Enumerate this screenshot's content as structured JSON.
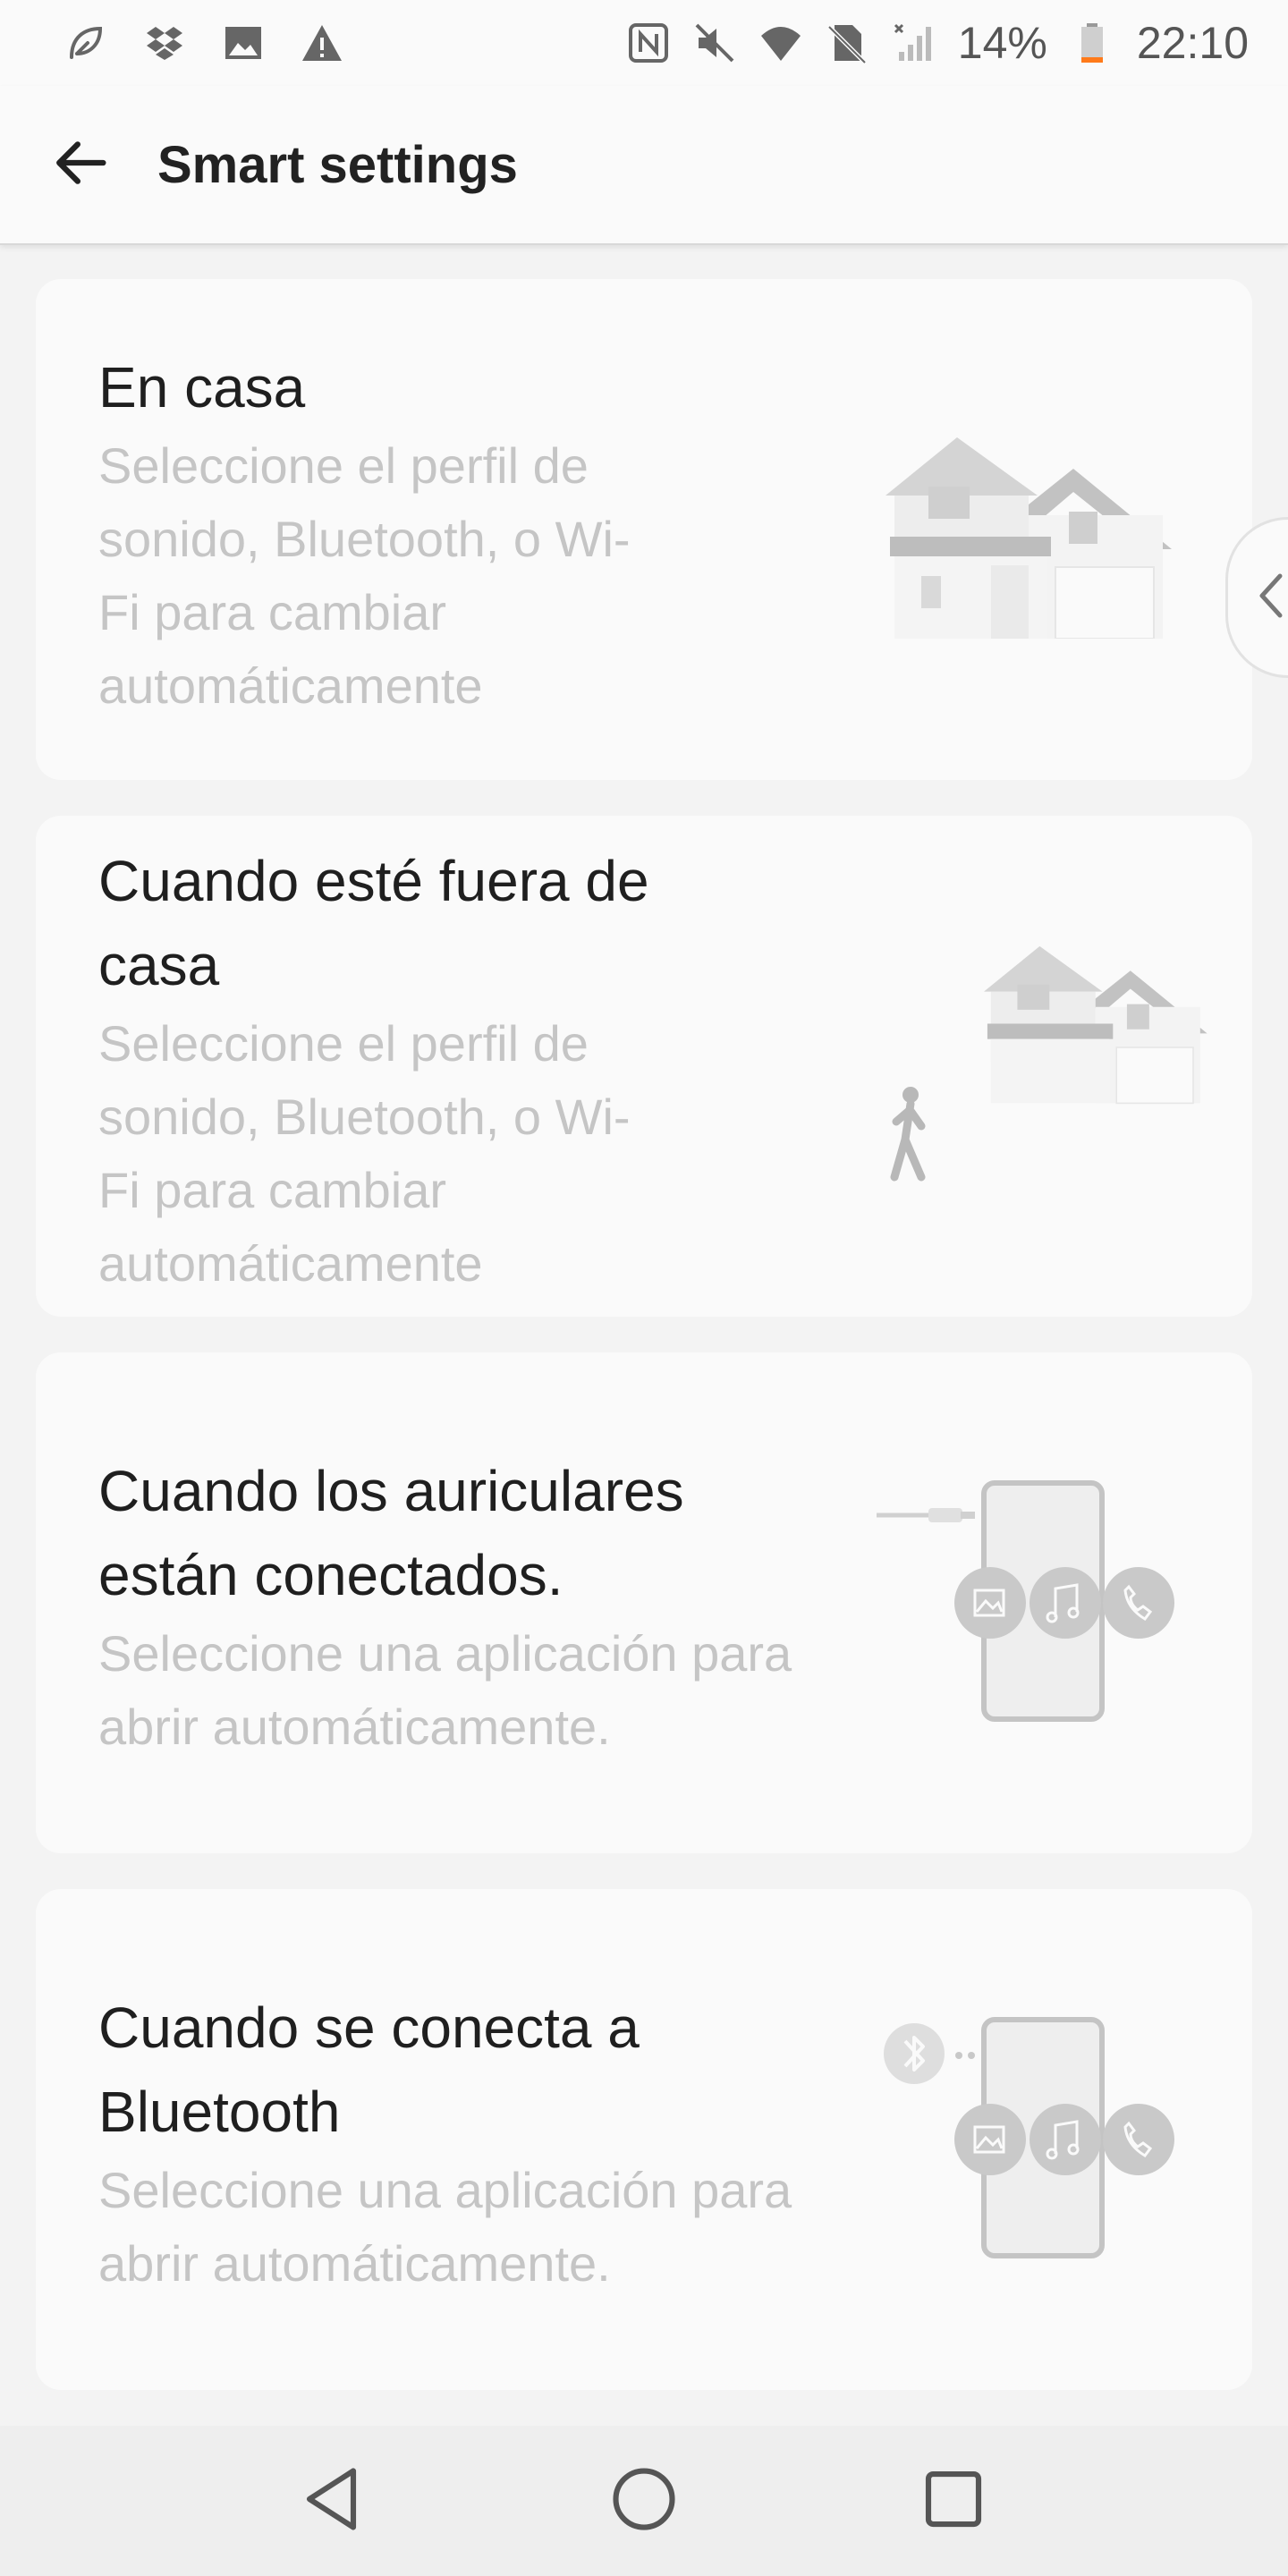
{
  "status_bar": {
    "left_icons": [
      "leaf-icon",
      "dropbox-icon",
      "image-icon",
      "warning-icon"
    ],
    "right_icons": [
      "nfc-icon",
      "mute-icon",
      "wifi-icon",
      "no-sim-icon",
      "signal-icon",
      "battery-icon"
    ],
    "battery_percent": "14%",
    "time": "22:10",
    "battery_level": 0.14,
    "battery_color": "#ff7a1a"
  },
  "app_bar": {
    "title": "Smart settings",
    "back_icon": "arrow-back-icon"
  },
  "cards": [
    {
      "title": "En casa",
      "description": "Seleccione el perfil de sonido, Bluetooth, o Wi-Fi para cambiar automáticamente",
      "illustration": "house-icon"
    },
    {
      "title": "Cuando esté fuera de casa",
      "description": "Seleccione el perfil de sonido, Bluetooth, o Wi-Fi para cambiar automáticamente",
      "illustration": "house-walking-person-icon"
    },
    {
      "title": "Cuando los auriculares están conectados.",
      "description": "Seleccione una aplicación para abrir automáticamente.",
      "illustration": "phone-earphone-apps-icon"
    },
    {
      "title": "Cuando se conecta a Bluetooth",
      "description": "Seleccione una aplicación para abrir automáticamente.",
      "illustration": "phone-bluetooth-apps-icon"
    }
  ],
  "side_handle": {
    "icon": "chevron-left-icon"
  },
  "nav_bar": {
    "buttons": [
      "back-triangle-icon",
      "home-circle-icon",
      "recents-square-icon"
    ]
  },
  "colors": {
    "background": "#f3f3f3",
    "card": "#fafafa",
    "title_text": "#1f1f1f",
    "desc_text": "#c5c5c5"
  }
}
